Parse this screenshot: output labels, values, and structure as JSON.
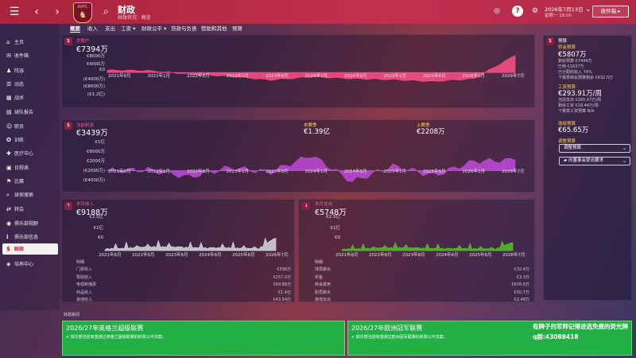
{
  "header": {
    "club_badge": "AVFC",
    "title": "财政",
    "subtitle": "财政状况 · 概览",
    "date": "2026年7月13日",
    "date_sub": "星期一 18:00",
    "inbox_label": "收件箱",
    "icons": [
      "back-icon",
      "forward-icon",
      "search-icon",
      "ball-icon",
      "help-icon",
      "gear-icon",
      "globe-icon"
    ]
  },
  "sidebar": {
    "items": [
      {
        "label": "主页",
        "icon": "⌂"
      },
      {
        "label": "收件箱",
        "icon": "✉"
      },
      {
        "label": "阵容",
        "icon": "♟"
      },
      {
        "label": "动态",
        "icon": "☰"
      },
      {
        "label": "战术",
        "icon": "▦"
      },
      {
        "label": "球队报告",
        "icon": "▤"
      },
      {
        "label": "职员",
        "icon": "☺"
      },
      {
        "label": "训练",
        "icon": "✪"
      },
      {
        "label": "医疗中心",
        "icon": "✚"
      },
      {
        "label": "日程表",
        "icon": "▣"
      },
      {
        "label": "比赛",
        "icon": "⚑"
      },
      {
        "label": "球探搜索",
        "icon": "⌕"
      },
      {
        "label": "转会",
        "icon": "⇄"
      },
      {
        "label": "俱乐部视野",
        "icon": "◉"
      },
      {
        "label": "俱乐部信息",
        "icon": "ℹ"
      },
      {
        "label": "财政",
        "icon": "$"
      },
      {
        "label": "培养中心",
        "icon": "◈"
      }
    ],
    "active": "财政"
  },
  "tabs": [
    "概要",
    "收入",
    "支出",
    "工资 ▾",
    "财政公平 ▾",
    "贷款与负债",
    "赞助和其他",
    "预算"
  ],
  "balance_panel": {
    "badge": "$",
    "label": "总账户",
    "value": "€7394万",
    "y_ticks": [
      "€8000万",
      "€4000万",
      "€0",
      "(€4000万)",
      "(€8000万)",
      "(€1.2亿)"
    ],
    "x_ticks": [
      "2021年8月",
      "2022年1月",
      "2022年8月",
      "2023年1月",
      "2023年8月",
      "2024年1月",
      "2024年8月",
      "2025年1月",
      "2025年8月",
      "2026年1月",
      "2026年7月"
    ],
    "color": "#ff4f86"
  },
  "chart_data": [
    {
      "type": "area",
      "name": "balance",
      "x": [
        "2021年8月",
        "2022年1月",
        "2022年8月",
        "2023年1月",
        "2023年8月",
        "2024年1月",
        "2024年8月",
        "2025年1月",
        "2025年8月",
        "2026年1月",
        "2026年7月"
      ],
      "values": [
        1000,
        800,
        -600,
        -1600,
        -3200,
        -1800,
        -2600,
        -3000,
        -3800,
        -2600,
        7394
      ],
      "ylim": [
        -12000,
        8000
      ]
    },
    {
      "type": "area",
      "name": "profit",
      "x": [
        "2021年8月",
        "2022年1月",
        "2022年8月",
        "2023年1月",
        "2023年8月",
        "2024年1月",
        "2024年8月",
        "2025年1月",
        "2025年8月",
        "2026年1月",
        "2026年7月"
      ],
      "values": [
        0,
        300,
        -2000,
        1000,
        -500,
        5000,
        -3500,
        1500,
        -1500,
        3000,
        3439
      ],
      "ylim": [
        -4000,
        10000
      ]
    },
    {
      "type": "area",
      "name": "income",
      "x": [
        "2021年8月",
        "2022年1月",
        "2022年8月",
        "2023年1月",
        "2023年8月",
        "2024年1月",
        "2024年8月",
        "2025年1月",
        "2025年8月",
        "2026年1月",
        "2026年7月"
      ],
      "values": [
        600,
        900,
        1800,
        2200,
        2000,
        1500,
        1200,
        1400,
        1000,
        800,
        9188
      ],
      "ylim": [
        0,
        25000
      ]
    },
    {
      "type": "area",
      "name": "expense",
      "x": [
        "2021年8月",
        "2022年1月",
        "2022年8月",
        "2023年1月",
        "2023年8月",
        "2024年1月",
        "2024年8月",
        "2025年1月",
        "2025年8月",
        "2026年1月",
        "2026年7月"
      ],
      "values": [
        500,
        700,
        1300,
        1600,
        1500,
        1100,
        900,
        1000,
        800,
        700,
        5748
      ],
      "ylim": [
        0,
        25000
      ]
    }
  ],
  "profit_panel": {
    "badge": "$",
    "label": "当前利润",
    "value": "€3439万",
    "label2": "本赛季",
    "value2": "€1.39亿",
    "label3": "上赛季",
    "value3": "€2208万",
    "y_ticks": [
      "€1亿",
      "€6000万",
      "€2000万",
      "(€2000万)",
      "(€4000万)"
    ],
    "x_ticks": [
      "2021年8月",
      "2022年1月",
      "2022年8月",
      "2023年1月",
      "2023年8月",
      "2024年1月",
      "2024年8月",
      "2025年1月",
      "2025年8月",
      "2026年1月",
      "2026年7月"
    ],
    "color": "#c04ad8"
  },
  "income_panel": {
    "badge": "↑",
    "label": "本月收入",
    "value": "€9188万",
    "y_ticks": [
      "€2.5亿",
      "€1亿",
      "€0"
    ],
    "x_ticks": [
      "2021年8月",
      "2022年8月",
      "2023年8月",
      "2024年8月",
      "2025年8月",
      "2026年7月"
    ],
    "color": "#d8d8e0",
    "rows_header": "明细",
    "rows": [
      {
        "label": "门票收入",
        "value": "€596万"
      },
      {
        "label": "赞助收入",
        "value": "€257.0万"
      },
      {
        "label": "电视转播费",
        "value": "€69.88万"
      },
      {
        "label": "商品收入",
        "value": "€1.4亿"
      },
      {
        "label": "其他收入",
        "value": "€43.54万"
      }
    ]
  },
  "expense_panel": {
    "badge": "↓",
    "label": "本月支出",
    "value": "€5748万",
    "y_ticks": [
      "€2.5亿",
      "€1亿",
      "€0"
    ],
    "x_ticks": [
      "2021年8月",
      "2022年8月",
      "2023年8月",
      "2024年8月",
      "2025年8月",
      "2026年7月"
    ],
    "color": "#52c02a",
    "rows_header": "明细",
    "rows": [
      {
        "label": "球员薪水",
        "value": "€32.4万"
      },
      {
        "label": "奖金",
        "value": "€3.3万"
      },
      {
        "label": "转会费用",
        "value": "€676.6万"
      },
      {
        "label": "职员薪水",
        "value": "€50.7万"
      },
      {
        "label": "其他支出",
        "value": "€2.48万"
      }
    ]
  },
  "right_panel": {
    "title": "预算",
    "transfer_label": "转会预算",
    "transfer_value": "€5807万",
    "transfer_lines": [
      "剩余预算 €7444万",
      "已用 €1637万",
      "已分配的收入 74%",
      "下赛季转会预算剩余 €632.0万"
    ],
    "wage_label": "工资预算",
    "wage_value": "€293.91万/周",
    "wage_lines": [
      "当前支出 €265.47万/周",
      "剩余工资 €28.44万/周",
      "下赛季工资预算 N/A"
    ],
    "scouting_label": "球探预算",
    "scouting_value": "€65.65万",
    "adjust_label": "调整预算",
    "adjust_btn": "调整预算",
    "request_btn": "向董事会提出要求"
  },
  "news": {
    "header": "财政新闻",
    "items": [
      {
        "title": "2026/27年英格兰超级联赛",
        "body": "俱乐部当前有望通过英格兰超级联赛的财政公平法案。"
      },
      {
        "title": "2026/27年欧洲冠军联赛",
        "body": "俱乐部当前有望通过欧洲冠军联赛的财政公平法案。"
      }
    ]
  },
  "overlay": {
    "line1": "有牌子的军师记得进选免费的荧光牌",
    "line2": "q群:43088418"
  }
}
